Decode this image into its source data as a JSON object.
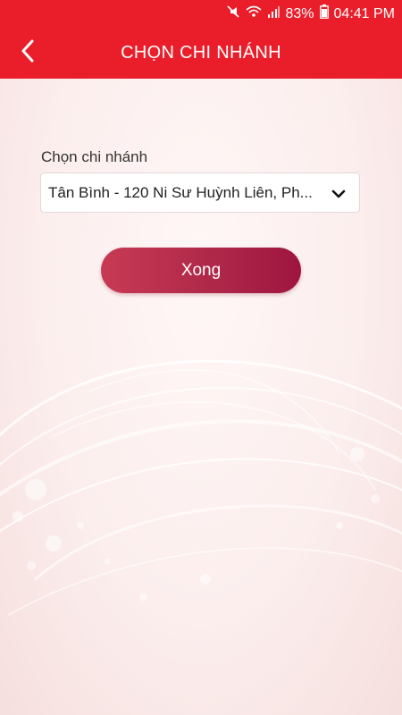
{
  "status_bar": {
    "battery": "83%",
    "time": "04:41 PM"
  },
  "header": {
    "title": "CHỌN CHI NHÁNH"
  },
  "form": {
    "label": "Chọn chi nhánh",
    "selected_branch": "Tân Bình - 120 Ni Sư Huỳnh Liên, Ph...",
    "done_label": "Xong"
  },
  "colors": {
    "brand_red": "#e91e2a",
    "button_gradient_start": "#c73a54",
    "button_gradient_end": "#9e1540"
  }
}
